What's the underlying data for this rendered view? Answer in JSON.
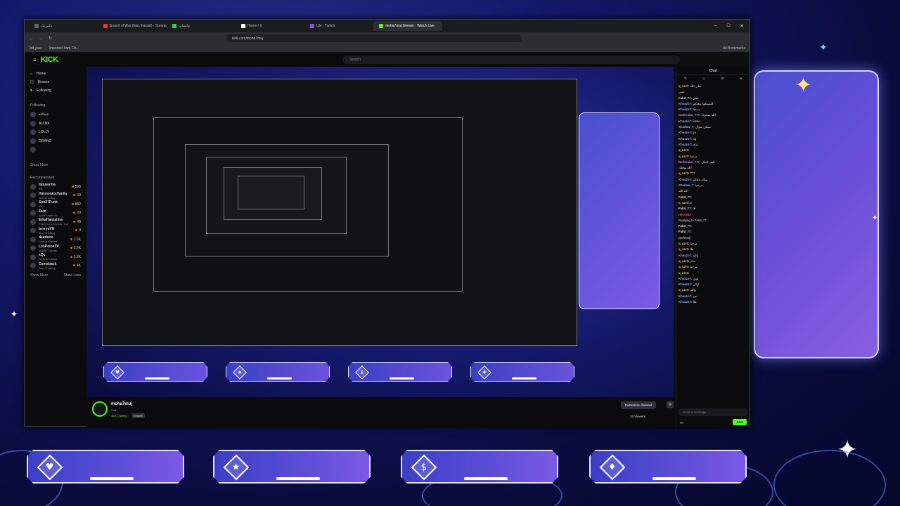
{
  "tabs": [
    {
      "label": "دکتر تک",
      "color": "#666"
    },
    {
      "label": "Sound of War (feat. Faraid) - Somnia",
      "color": "#e33"
    },
    {
      "label": "واتساپ",
      "color": "#25d366"
    },
    {
      "label": "Home / X",
      "color": "#fff"
    },
    {
      "label": "Lile - Twitch",
      "color": "#9146ff"
    },
    {
      "label": "moha7muj Stream - Watch Live",
      "color": "#53fc18"
    }
  ],
  "window_controls": [
    "–",
    "□",
    "✕"
  ],
  "address": {
    "url": "kick.com/moha7muj"
  },
  "bookmarks": {
    "items": [
      "3rd year",
      "Imported from Ch..."
    ],
    "all": "All Bookmarks"
  },
  "kick": {
    "logo": "KICK",
    "search_placeholder": "Search",
    "nav": [
      {
        "label": "Home",
        "icon": "⌂"
      },
      {
        "label": "Browse",
        "icon": "◫"
      },
      {
        "label": "Following",
        "icon": "♥"
      }
    ],
    "following_heading": "Following",
    "following": [
      {
        "name": "عبدالله",
        "count": ""
      },
      {
        "name": "ALLNK",
        "count": ""
      },
      {
        "name": "LOLLY",
        "count": ""
      },
      {
        "name": "ORANG",
        "count": ""
      },
      {
        "name": "",
        "count": ""
      }
    ],
    "show_more_label": "Show More",
    "recommended_heading": "Recommended",
    "recommended": [
      {
        "name": "Ilyasaxma",
        "cat": "IRL",
        "viewers": "595"
      },
      {
        "name": "HarmonicsVanity",
        "cat": "Just Chatting",
        "viewers": "69"
      },
      {
        "name": "SanZ7Funk",
        "cat": "IRL",
        "viewers": "882"
      },
      {
        "name": "Zard",
        "cat": "Apex Legends",
        "viewers": "29"
      },
      {
        "name": "ErkaHarpatma",
        "cat": "Pokemon Legends: Z-A",
        "viewers": "46"
      },
      {
        "name": "berryoVN",
        "cat": "Just Chatting",
        "viewers": "9"
      },
      {
        "name": "deedaxx",
        "cat": "Slots & Casino",
        "viewers": "1.5K"
      },
      {
        "name": "LosPolosTV",
        "cat": "Mobile Games",
        "viewers": "6.6K"
      },
      {
        "name": "xQc",
        "cat": "Slots & Casino",
        "viewers": "9.3K"
      },
      {
        "name": "Comeback",
        "cat": "Just Chatting",
        "viewers": "4K"
      }
    ],
    "show_more": "Show More",
    "show_less": "Show Less"
  },
  "streamer": {
    "name": "moha7muj",
    "title": "Cod",
    "category": "Just Chatting",
    "language": "English",
    "customize": "Customize channel",
    "viewers": "14 Viewers"
  },
  "chat": {
    "title": "Chat",
    "messages": [
      {
        "user": "q_uzr0:",
        "text": "صلى الله",
        "color": "#e9c46a"
      },
      {
        "user": "",
        "text": "عيني",
        "color": "#53fc18"
      },
      {
        "user": "Fahd_77:",
        "text": "عيني",
        "color": "#ddd"
      },
      {
        "user": "Khoazo7:",
        "text": "استمتعوا بوقتكم",
        "color": "#8ab4ff"
      },
      {
        "user": "Khoazo7:",
        "text": "مرحبا",
        "color": "#8ab4ff"
      },
      {
        "user": "DarkCuba_777:",
        "text": "الله يسعدك",
        "color": "#c77dff"
      },
      {
        "user": "Khoazo7:",
        "text": "lololo",
        "color": "#8ab4ff"
      },
      {
        "user": "Shadow_7:",
        "text": "ممكن سؤال",
        "color": "#8ab4ff"
      },
      {
        "user": "Khoazo7:",
        "text": "yo",
        "color": "#8ab4ff"
      },
      {
        "user": "Khoazo7:",
        "text": "og",
        "color": "#8ab4ff"
      },
      {
        "user": "Khoazo7:",
        "text": "تمام",
        "color": "#8ab4ff"
      },
      {
        "user": "q_uzr0:",
        "text": "",
        "color": "#e9c46a"
      },
      {
        "user": "q_uzr0:",
        "text": "مرحبا",
        "color": "#e9c46a"
      },
      {
        "user": "DarkCuba_777:",
        "text": "كيف الحال",
        "color": "#c77dff"
      },
      {
        "user": "",
        "text": "الله يوفقك",
        "color": "#ddd"
      },
      {
        "user": "q_uzr0:",
        "text": "777",
        "color": "#e9c46a"
      },
      {
        "user": "Khoazo7:",
        "text": "سلام عليكم",
        "color": "#8ab4ff"
      },
      {
        "user": "Shadow_7:",
        "text": "مرحبا",
        "color": "#8ab4ff"
      },
      {
        "user": "",
        "text": "الله الله",
        "color": "#ddd"
      },
      {
        "user": "Fahd_77:",
        "text": "",
        "color": "#ddd"
      },
      {
        "user": "q_uzr0:",
        "text": "Z",
        "color": "#e9c46a"
      },
      {
        "user": "Fahd_77:",
        "text": "ok",
        "color": "#ddd"
      },
      {
        "user": "HIKARU:",
        "text": "",
        "color": "#ff4d6d"
      },
      {
        "user": "",
        "text": "Replying to Fahd_77",
        "color": "#888"
      },
      {
        "user": "Fahd_77:",
        "text": "",
        "color": "#ddd"
      },
      {
        "user": "Fahd_77:",
        "text": "",
        "color": "#ddd"
      },
      {
        "user": "",
        "text": "(Deleted)",
        "color": "#888"
      },
      {
        "user": "q_uzr0:",
        "text": "مرحبا",
        "color": "#e9c46a"
      },
      {
        "user": "q_uzr0:",
        "text": "هلا",
        "color": "#e9c46a"
      },
      {
        "user": "Khoazo7:",
        "text": "يالله",
        "color": "#8ab4ff"
      },
      {
        "user": "q_uzr0:",
        "text": "تمام",
        "color": "#e9c46a"
      },
      {
        "user": "q_uzr0:",
        "text": "مرحبا",
        "color": "#e9c46a"
      },
      {
        "user": "q_uzr0:",
        "text": "",
        "color": "#e9c46a"
      },
      {
        "user": "Khoazo7:",
        "text": "قوي",
        "color": "#8ab4ff"
      },
      {
        "user": "Khoazo7:",
        "text": "اوكي",
        "color": "#8ab4ff"
      },
      {
        "user": "q_uzr0:",
        "text": "والله",
        "color": "#e9c46a"
      },
      {
        "user": "Khoazo7:",
        "text": "نعم",
        "color": "#8ab4ff"
      },
      {
        "user": "Khoazo7:",
        "text": "هلا",
        "color": "#8ab4ff"
      }
    ],
    "input_placeholder": "Send a message",
    "count": "60",
    "send": "Chat"
  },
  "bottom_icons": [
    "♥",
    "★",
    "$",
    "♦"
  ],
  "colors": {
    "accent": "#53fc18",
    "panel": "#5a4fd6"
  }
}
